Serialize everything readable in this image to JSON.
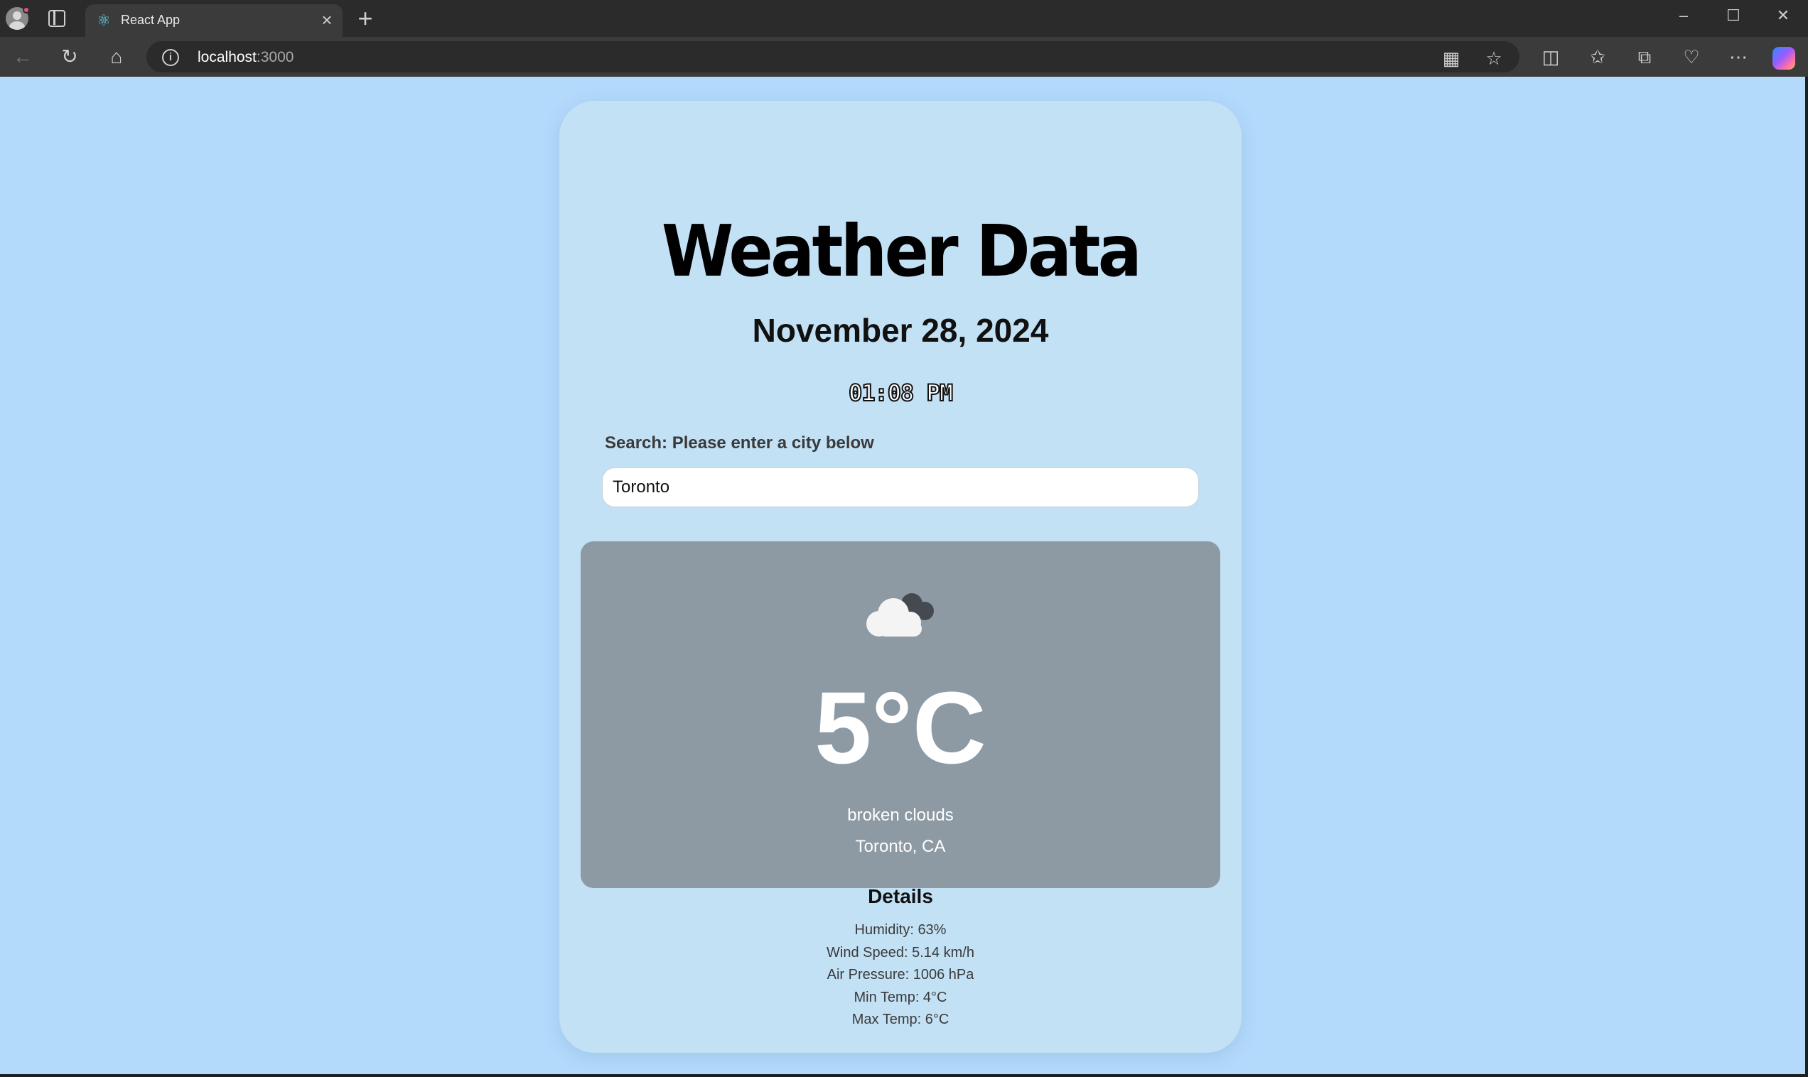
{
  "browser": {
    "tab_title": "React App",
    "url_host": "localhost",
    "url_port": ":3000"
  },
  "app": {
    "title": "Weather Data",
    "date": "November 28, 2024",
    "time": "01:08 PM",
    "search_label": "Search: Please enter a city below",
    "search_value": "Toronto",
    "current": {
      "icon": "broken-clouds-icon",
      "temperature": "5°C",
      "description": "broken clouds",
      "location": "Toronto, CA"
    },
    "details": {
      "title": "Details",
      "items": [
        "Humidity: 63%",
        "Wind Speed: 5.14 km/h",
        "Air Pressure: 1006 hPa",
        "Min Temp: 4°C",
        "Max Temp: 6°C"
      ]
    }
  },
  "colors": {
    "page_background": "#b3d9fb",
    "card_background": "#c3e1f5",
    "weather_box": "#8d9aa4"
  }
}
